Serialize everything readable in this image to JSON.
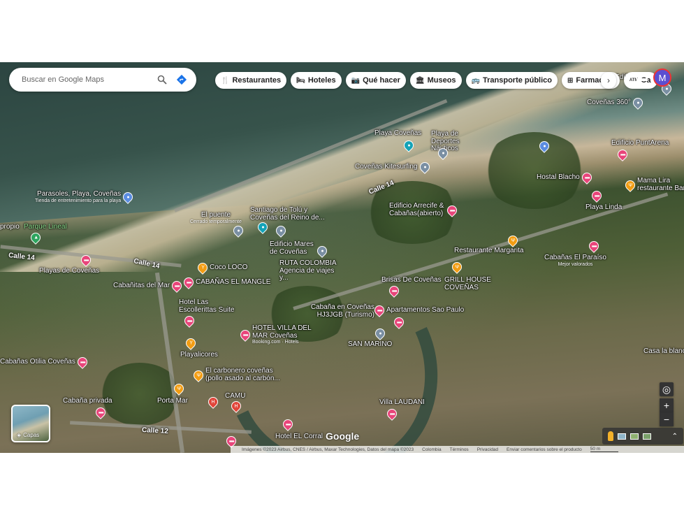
{
  "search": {
    "placeholder": "Buscar en Google Maps"
  },
  "chips": [
    {
      "icon": "utensils-icon",
      "glyph": "🍴",
      "label": "Restaurantes"
    },
    {
      "icon": "bed-icon",
      "glyph": "🛏",
      "label": "Hoteles"
    },
    {
      "icon": "camera-icon",
      "glyph": "📷",
      "label": "Qué hacer"
    },
    {
      "icon": "museum-icon",
      "glyph": "🏛",
      "label": "Museos"
    },
    {
      "icon": "bus-icon",
      "glyph": "🚌",
      "label": "Transporte público"
    },
    {
      "icon": "pharmacy-icon",
      "glyph": "⊞",
      "label": "Farmacias"
    },
    {
      "icon": "atm-icon",
      "glyph": "ATM",
      "label": "Ca"
    }
  ],
  "avatar": {
    "initial": "M"
  },
  "streets": [
    "Calle 14",
    "Calle 14",
    "Calle 14",
    "Calle 12"
  ],
  "places": {
    "p1": "Parasoles, Playa, Coveñas",
    "p1s": "Tienda de entretenimiento para la playa",
    "p2": "Parque Lineal",
    "p3": "Playas de Coveñas",
    "p4": "Cabañitas del Mar",
    "p5": "CABAÑAS EL MANGLE",
    "p6": "Hotel Las Escollerittas Suite",
    "p7": "Coco LOCO",
    "p8": "El puente",
    "p8s": "Cerrado temporalmente",
    "p9": "Santiago de Tolú y Coveñas del Reino de...",
    "p10": "Edificio Mares de Coveñas",
    "p11": "RUTA COLOMBIA Agencia de viajes y...",
    "p12": "Playa Coveñas",
    "p13": "Playa de Deportes Náuticos",
    "p14": "Coveñas Kitesurfing",
    "p15": "Edificio Arrecife & Cabañas(abierto)",
    "p16": "Coveñas 360°",
    "p17": "Edificio PuntArena",
    "p18": "Hostal Blacho",
    "p19": "Mama Lira restaurante Bar",
    "p20": "Playa Linda",
    "p21": "Restaurante Margarita",
    "p22": "Cabañas El Paraíso",
    "p22s": "Mejor valorados",
    "p23": "Brisas De Coveñas",
    "p24": "GRILL HOUSE COVEÑAS",
    "p25": "Cabaña en Coveñas HJ3JGB (Turismo)",
    "p26": "Apartamentos Sao Paulo",
    "p27": "HOTEL VILLA DEL MAR Coveñas",
    "p27s": "Booking.com · Hotels",
    "p28": "SAN MARINO",
    "p29": "Playalicores",
    "p30": "El carbonero coveñas (pollo asado al carbón...",
    "p31": "Cabañas Otilia Coveñas",
    "p32": "CAMU",
    "p33": "Porta Mar",
    "p34": "Cabaña privada",
    "p35": "Villa LAUDANI",
    "p36": "Hotel EL Corral",
    "p37": "Casa la blanca",
    "p38": "Edificio Puerto",
    "p39": "propio"
  },
  "controls": {
    "layers_label": "Capas",
    "zoom_in": "+",
    "zoom_out": "−"
  },
  "footer": {
    "imagery": "Imágenes ©2023 Airbus, CNES / Airbus, Maxar Technologies, Datos del mapa ©2023",
    "country": "Colombia",
    "terms": "Términos",
    "privacy": "Privacidad",
    "feedback": "Enviar comentarios sobre el producto",
    "scale": "50 m",
    "watermark": "Google"
  }
}
